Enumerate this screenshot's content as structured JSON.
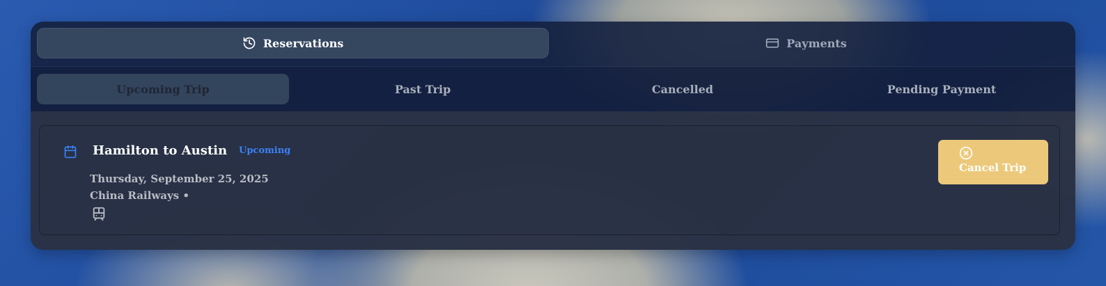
{
  "top_tabs": [
    {
      "label": "Reservations",
      "icon": "history-icon",
      "active": true
    },
    {
      "label": "Payments",
      "icon": "credit-card-icon",
      "active": false
    }
  ],
  "sub_tabs": [
    {
      "label": "Upcoming Trip",
      "active": true
    },
    {
      "label": "Past Trip",
      "active": false
    },
    {
      "label": "Cancelled",
      "active": false
    },
    {
      "label": "Pending Payment",
      "active": false
    }
  ],
  "trip": {
    "icon": "calendar-icon",
    "title": "Hamilton to Austin",
    "status": "Upcoming",
    "date": "Thursday, September 25, 2025",
    "operator": "China Railways •",
    "transport_icon": "train-icon",
    "cancel_label": "Cancel Trip",
    "cancel_icon": "x-circle-icon"
  },
  "colors": {
    "status_blue": "#3b82f6",
    "cancel_button": "#ecc97a",
    "active_tab": "#35465f"
  }
}
